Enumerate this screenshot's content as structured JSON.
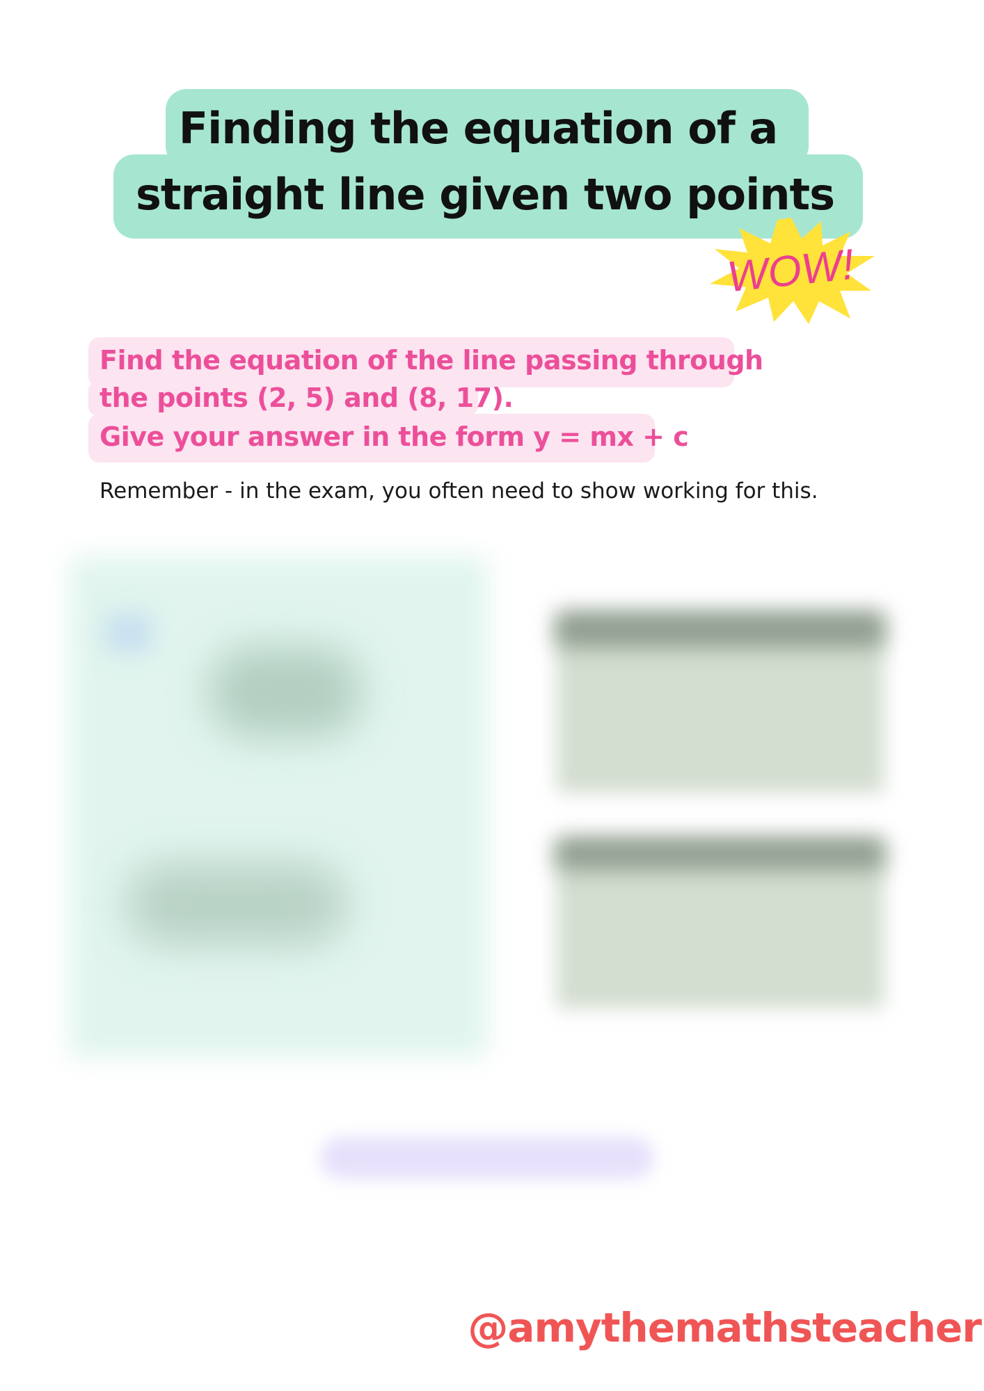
{
  "title": {
    "line1": "Finding the equation of a",
    "line2": "straight line given two points"
  },
  "sticker": {
    "text": "WOW!",
    "colors": {
      "burst": "#ffe23a",
      "text": "#ec3f8f"
    }
  },
  "question": {
    "line1": "Find the equation of the line passing through",
    "line2": "the points (2, 5) and (8, 17).",
    "line3": "Give your answer in the form y = mx + c"
  },
  "note": "Remember - in the exam, you often need to show working for this.",
  "handle": "@amythemathsteacher",
  "colors": {
    "title_highlight": "#a6e6d1",
    "question_text": "#ec4f9a",
    "question_highlight": "#fce4f0",
    "handle": "#f05555"
  }
}
